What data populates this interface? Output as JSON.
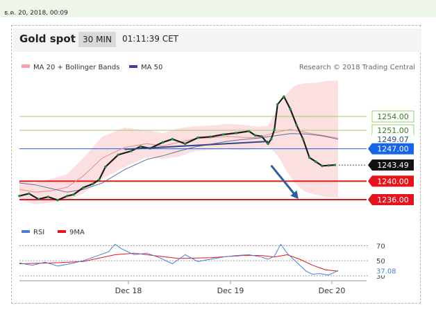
{
  "header": {
    "date_time": "ธ.ค. 20, 2018, 00:09",
    "title": "Gold spot",
    "timeframe": "30 MIN",
    "clock": "01:11:39 CET"
  },
  "legend": {
    "ma20_bb": "MA 20 + Bollinger Bands",
    "ma50": "MA 50",
    "credit": "Research © 2018 Trading Central",
    "rsi": "RSI",
    "ma9": "9MA"
  },
  "colors": {
    "bollinger_fill": "#fbdfe1",
    "ma20": "#e88a8a",
    "ma50": "#2e4a86",
    "resistance": "#9acd6a",
    "support": "#e5141c",
    "pivot": "#1565e6",
    "price_tag": "#111111",
    "rsi": "#4a7fd6",
    "rsi_ma": "#e5141c"
  },
  "chart_data": [
    {
      "type": "candlestick",
      "title": "Gold spot",
      "x_ticks": [
        "Dec 18",
        "Dec 19",
        "Dec 20"
      ],
      "ylim": [
        1233,
        1263
      ],
      "series": [
        {
          "name": "Bollinger",
          "kind": "band",
          "t": [
            0,
            0.05,
            0.1,
            0.15,
            0.2,
            0.26,
            0.33,
            0.4,
            0.45,
            0.5,
            0.55,
            0.6,
            0.65,
            0.7,
            0.75,
            0.78,
            0.8,
            0.82,
            0.84,
            0.86,
            0.88,
            0.9,
            0.93,
            0.95,
            0.97,
            1.0
          ],
          "upper": [
            1240.0,
            1239.6,
            1240.5,
            1241.5,
            1245.0,
            1249.6,
            1251.6,
            1251.0,
            1250.4,
            1251.4,
            1251.9,
            1252.0,
            1252.4,
            1252.2,
            1251.8,
            1252.0,
            1254.5,
            1256.8,
            1259.0,
            1260.5,
            1261.0,
            1261.2,
            1261.3,
            1261.5,
            1261.7,
            1261.8
          ],
          "lower": [
            1236.0,
            1235.0,
            1235.4,
            1235.9,
            1237.3,
            1240.5,
            1243.1,
            1245.2,
            1244.8,
            1245.3,
            1246.5,
            1246.8,
            1246.9,
            1246.7,
            1247.0,
            1247.3,
            1246.4,
            1244.5,
            1242.0,
            1240.0,
            1238.5,
            1237.6,
            1237.1,
            1236.8,
            1236.6,
            1236.5
          ]
        },
        {
          "name": "MA 20",
          "kind": "line",
          "t": [
            0,
            0.05,
            0.1,
            0.15,
            0.2,
            0.26,
            0.33,
            0.4,
            0.45,
            0.5,
            0.55,
            0.6,
            0.65,
            0.7,
            0.75,
            0.8,
            0.85,
            0.9,
            0.95,
            1.0
          ],
          "values": [
            1238.2,
            1237.6,
            1237.9,
            1238.7,
            1241.1,
            1245.0,
            1247.3,
            1248.1,
            1247.6,
            1248.4,
            1249.2,
            1249.4,
            1249.7,
            1249.5,
            1249.4,
            1250.5,
            1251.2,
            1250.5,
            1249.9,
            1249.3
          ]
        },
        {
          "name": "MA 50",
          "kind": "line",
          "t": [
            0,
            0.05,
            0.1,
            0.15,
            0.2,
            0.26,
            0.33,
            0.4,
            0.45,
            0.5,
            0.55,
            0.6,
            0.65,
            0.7,
            0.75,
            0.8,
            0.85,
            0.9,
            0.95,
            1.0
          ],
          "values": [
            1239.6,
            1239.2,
            1238.4,
            1237.6,
            1238.2,
            1239.6,
            1242.5,
            1244.7,
            1245.5,
            1246.5,
            1247.4,
            1248.0,
            1248.6,
            1249.0,
            1249.3,
            1249.8,
            1250.3,
            1250.2,
            1249.8,
            1249.1
          ]
        },
        {
          "name": "Price",
          "kind": "line",
          "t": [
            0,
            0.03,
            0.06,
            0.09,
            0.12,
            0.15,
            0.17,
            0.2,
            0.23,
            0.25,
            0.27,
            0.31,
            0.35,
            0.38,
            0.41,
            0.45,
            0.48,
            0.52,
            0.56,
            0.6,
            0.64,
            0.68,
            0.72,
            0.74,
            0.76,
            0.78,
            0.79,
            0.8,
            0.81,
            0.83,
            0.85,
            0.87,
            0.89,
            0.91,
            0.93,
            0.95,
            0.97,
            0.99
          ],
          "values": [
            1236.8,
            1237.3,
            1236.1,
            1236.6,
            1235.9,
            1236.8,
            1237.1,
            1238.6,
            1239.4,
            1240.3,
            1243.1,
            1245.7,
            1246.5,
            1247.5,
            1247.1,
            1248.4,
            1249.1,
            1248.1,
            1249.4,
            1249.6,
            1250.1,
            1250.4,
            1250.8,
            1249.9,
            1249.7,
            1248.1,
            1249.1,
            1251.1,
            1256.6,
            1258.3,
            1255.6,
            1252.1,
            1249.1,
            1245.1,
            1244.2,
            1243.3,
            1243.4,
            1243.5
          ]
        }
      ],
      "levels": [
        {
          "value": 1254.0,
          "label": "1254.00",
          "kind": "resistance"
        },
        {
          "value": 1251.0,
          "label": "1251.00",
          "kind": "resistance"
        },
        {
          "value": 1249.07,
          "label": "1249.07",
          "kind": "ma50"
        },
        {
          "value": 1247.0,
          "label": "1247.00",
          "kind": "pivot"
        },
        {
          "value": 1243.49,
          "label": "1243.49",
          "kind": "price"
        },
        {
          "value": 1240.0,
          "label": "1240.00",
          "kind": "support"
        },
        {
          "value": 1236.0,
          "label": "1236.00",
          "kind": "support"
        }
      ],
      "trendline": {
        "t": [
          0.33,
          0.78
        ],
        "values": [
          1246.9,
          1248.6
        ]
      },
      "forecast_arrow": {
        "t": [
          0.79,
          0.87
        ],
        "values": [
          1243.4,
          1236.6
        ]
      }
    },
    {
      "type": "line",
      "title": "RSI",
      "ylim": [
        28,
        76
      ],
      "ticks": [
        "70",
        "50",
        "30"
      ],
      "current_label": "37.08",
      "series": [
        {
          "name": "RSI",
          "t": [
            0,
            0.04,
            0.08,
            0.12,
            0.16,
            0.2,
            0.24,
            0.28,
            0.3,
            0.32,
            0.36,
            0.4,
            0.44,
            0.48,
            0.52,
            0.56,
            0.6,
            0.64,
            0.68,
            0.72,
            0.76,
            0.78,
            0.8,
            0.82,
            0.84,
            0.86,
            0.88,
            0.9,
            0.92,
            0.94,
            0.97,
            1.0
          ],
          "values": [
            47,
            44,
            48,
            43,
            46,
            50,
            56,
            62,
            72,
            66,
            58,
            60,
            54,
            46,
            58,
            49,
            52,
            55,
            57,
            58,
            55,
            52,
            56,
            72,
            60,
            52,
            44,
            36,
            32,
            33,
            31,
            37
          ]
        },
        {
          "name": "9MA",
          "t": [
            0,
            0.1,
            0.2,
            0.3,
            0.36,
            0.42,
            0.5,
            0.6,
            0.7,
            0.76,
            0.8,
            0.84,
            0.88,
            0.92,
            0.96,
            1.0
          ],
          "values": [
            46,
            47,
            49,
            58,
            60,
            57,
            53,
            54,
            57,
            57,
            55,
            58,
            52,
            44,
            38,
            36
          ]
        }
      ]
    }
  ]
}
